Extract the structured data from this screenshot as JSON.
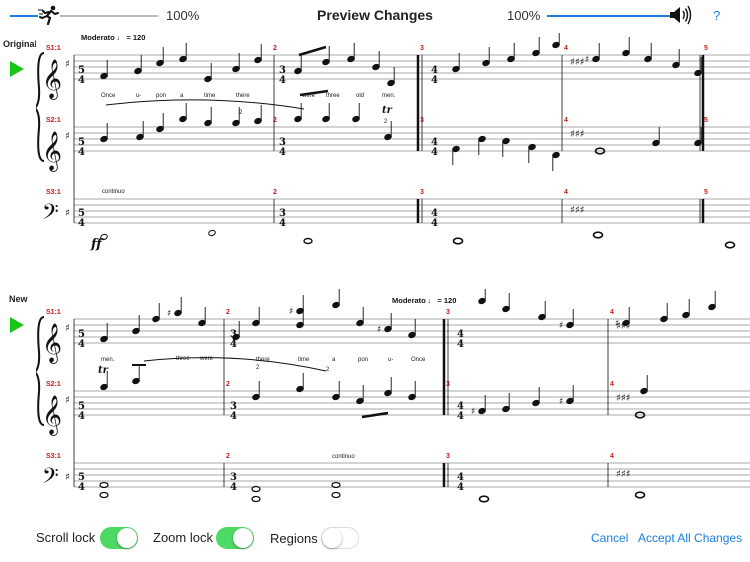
{
  "header": {
    "title": "Preview Changes",
    "tempo_percent": "100%",
    "volume_percent": "100%",
    "tempo_fill_fraction": 0.1,
    "volume_fill_fraction": 1.0,
    "help_label": "?"
  },
  "original": {
    "label": "Original",
    "tempo_text": "Moderato ♩ = 120",
    "staves": [
      "S1:1",
      "S2:1",
      "S3:1"
    ],
    "measures": [
      "2",
      "3",
      "4",
      "5"
    ],
    "lyrics": [
      "Once",
      "u-",
      "pon",
      "a",
      "time",
      "there",
      "were",
      "three",
      "old",
      "men."
    ],
    "continuo": "continuo",
    "dynamic": "ff",
    "tuplet": "2",
    "trill_number": "2"
  },
  "new": {
    "label": "New",
    "tempo_text": "Moderato ♩ = 120",
    "staves": [
      "S1:1",
      "S2:1",
      "S3:1"
    ],
    "measures": [
      "2",
      "3",
      "4"
    ],
    "lyrics": [
      "men.",
      "three",
      "were",
      "there",
      "time",
      "a",
      "pon",
      "u-",
      "Once"
    ],
    "continuo": "continuo",
    "tuplet_1": "2",
    "tuplet_2": "2"
  },
  "footer": {
    "scroll_lock_label": "Scroll lock",
    "scroll_lock_on": true,
    "zoom_lock_label": "Zoom lock",
    "zoom_lock_on": true,
    "regions_label": "Regions",
    "regions_on": false,
    "cancel_label": "Cancel",
    "accept_label": "Accept All Changes"
  },
  "colors": {
    "accent": "#1a7fe0",
    "play": "#17c717",
    "toggle_on": "#4cd964",
    "measure_number": "#d01818"
  }
}
